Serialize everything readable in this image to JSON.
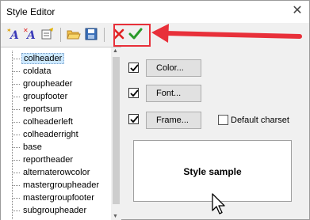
{
  "window": {
    "title": "Style Editor"
  },
  "toolbar": {
    "buttons": [
      {
        "name": "add-style-icon",
        "label": "A"
      },
      {
        "name": "delete-style-icon",
        "label": "A"
      },
      {
        "name": "rename-style-icon",
        "label": ""
      },
      {
        "name": "open-icon",
        "label": ""
      },
      {
        "name": "save-icon",
        "label": ""
      },
      {
        "name": "cancel-icon",
        "label": "✕"
      },
      {
        "name": "ok-checkmark-icon",
        "label": "✔"
      }
    ],
    "accent": "#e8303a"
  },
  "styles_list": {
    "items": [
      "colheader",
      "coldata",
      "groupheader",
      "groupfooter",
      "reportsum",
      "colheaderleft",
      "colheaderright",
      "base",
      "reportheader",
      "alternaterowcolor",
      "mastergroupheader",
      "mastergroupfooter",
      "subgroupheader"
    ],
    "selected": "colheader"
  },
  "options": {
    "color_button": "Color...",
    "font_button": "Font...",
    "frame_button": "Frame...",
    "default_charset_label": "Default charset",
    "color_checked": true,
    "font_checked": true,
    "frame_checked": true,
    "default_charset_checked": false
  },
  "sample": {
    "text": "Style sample"
  }
}
